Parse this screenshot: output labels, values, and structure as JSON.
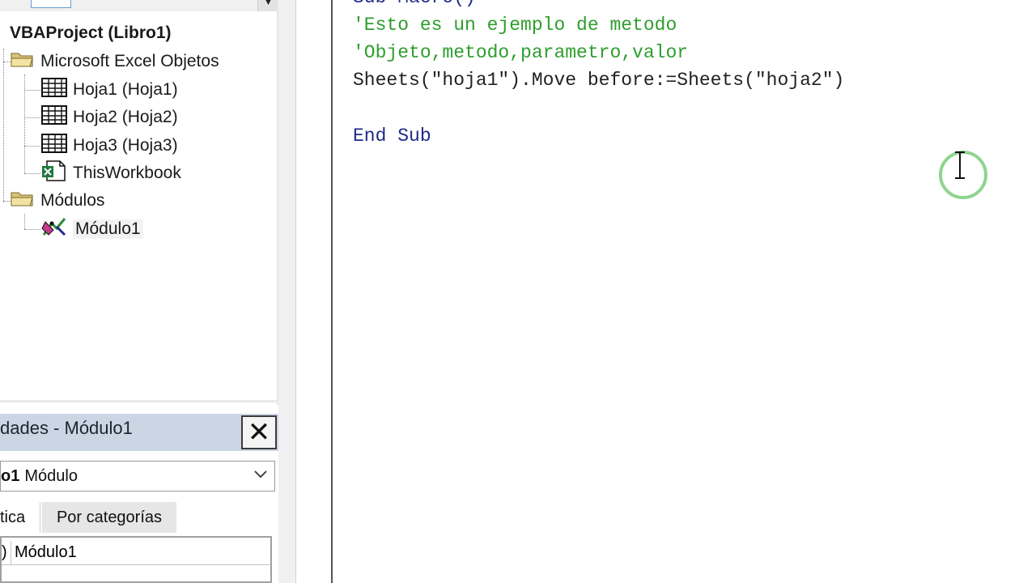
{
  "project_tree": {
    "root": "VBAProject (Libro1)",
    "folders": [
      {
        "label": "Microsoft Excel Objetos",
        "items": [
          "Hoja1 (Hoja1)",
          "Hoja2 (Hoja2)",
          "Hoja3 (Hoja3)",
          "ThisWorkbook"
        ]
      },
      {
        "label": "Módulos",
        "items": [
          "Módulo1"
        ]
      }
    ]
  },
  "properties": {
    "title": "dades - Módulo1",
    "close_symbol": "✕",
    "combo_bold": "o1",
    "combo_text": "Módulo",
    "tab_alpha": "tica",
    "tab_categories": "Por categorías",
    "grid_row_name": ")",
    "grid_row_value": "Módulo1"
  },
  "code_lines": {
    "line0": "Sub Macro()",
    "line1": "'Esto es un ejemplo de metodo",
    "line2": "'Objeto,metodo,parametro,valor",
    "line3": "Sheets(\"hoja1\").Move before:=Sheets(\"hoja2\")",
    "line5": "End Sub"
  },
  "colors": {
    "comment": "#2e9e2e",
    "keyword": "#1f2a8a",
    "properties_title_bg": "#cbd6e4",
    "cursor_ring": "#8fd48f"
  }
}
